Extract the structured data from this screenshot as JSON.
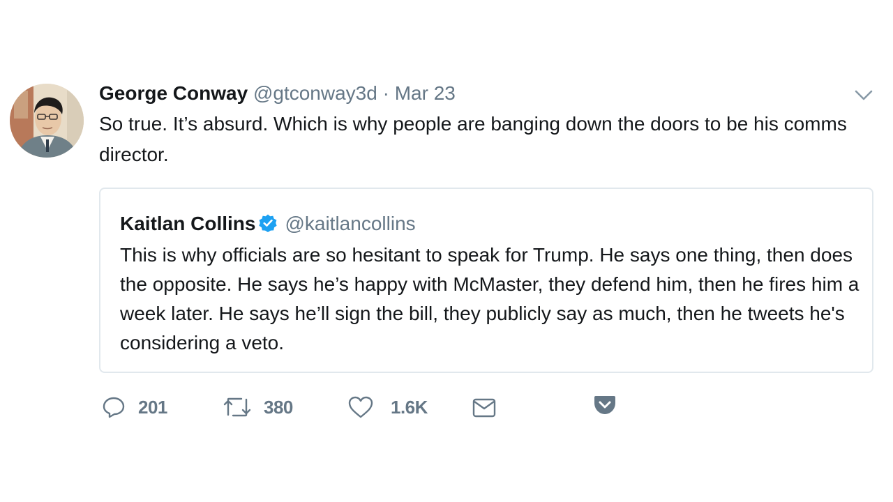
{
  "tweet": {
    "author_name": "George Conway",
    "author_handle": "@gtconway3d",
    "separator": "·",
    "date": "Mar 23",
    "text": "So true.  It’s absurd.  Which is why people are banging down the doors to be his comms director.",
    "avatar_icon": "avatar-portrait"
  },
  "quoted_tweet": {
    "author_name": "Kaitlan Collins",
    "verified_icon": "verified-badge-icon",
    "author_handle": "@kaitlancollins",
    "text": "This is why officials are so hesitant to speak for Trump. He says one thing, then does the opposite. He says he’s happy with McMaster, they defend him, then he fires him a week later. He says he’ll sign the bill, they publicly say as much, then he tweets he's considering a veto."
  },
  "actions": {
    "reply_count": "201",
    "retweet_count": "380",
    "like_count": "1.6K",
    "icons": [
      "reply-icon",
      "retweet-icon",
      "like-icon",
      "direct-message-icon",
      "pocket-icon"
    ]
  },
  "colors": {
    "text": "#14171a",
    "secondary": "#657786",
    "border": "#e1e8ed",
    "verified": "#1da1f2"
  }
}
